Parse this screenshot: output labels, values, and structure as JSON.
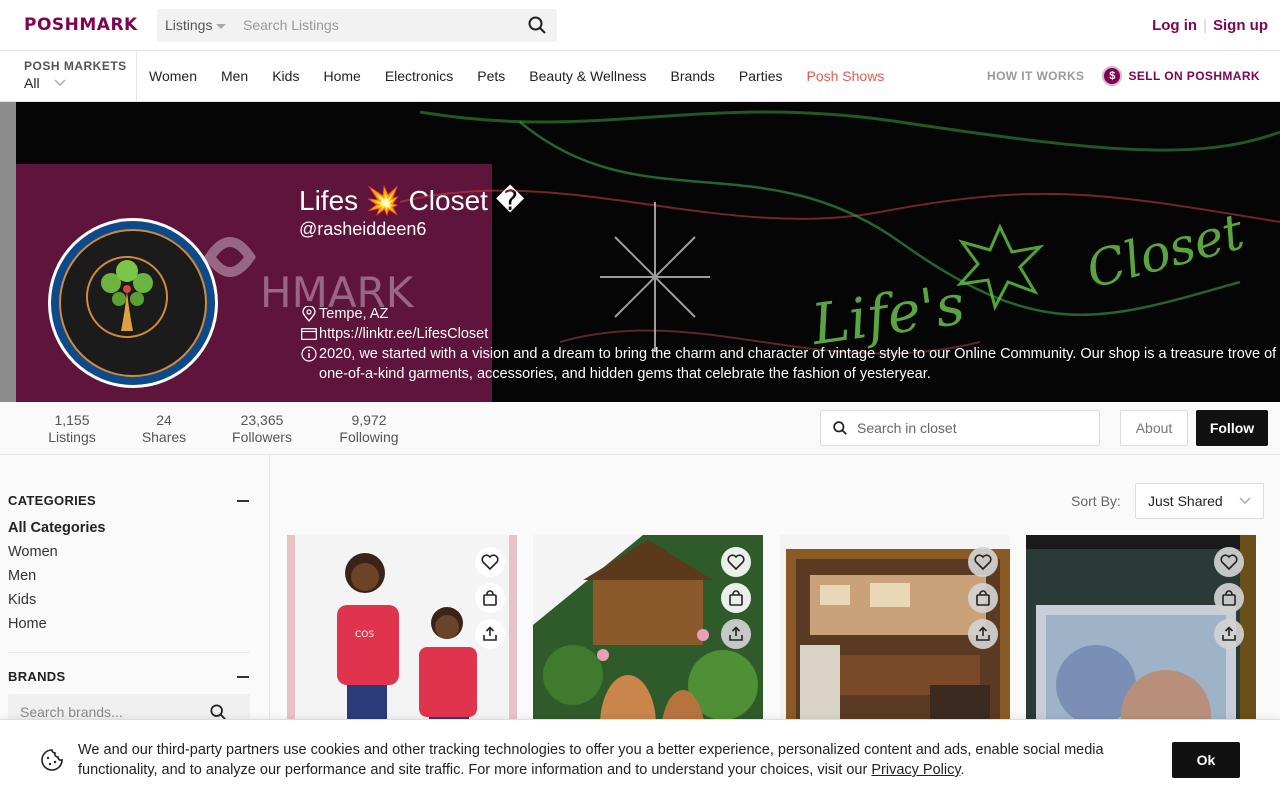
{
  "header": {
    "logo": "POSHMARK",
    "search_type": "Listings",
    "search_placeholder": "Search Listings",
    "login": "Log in",
    "signup": "Sign up"
  },
  "nav": {
    "markets_label": "POSH MARKETS",
    "markets_value": "All",
    "links": [
      "Women",
      "Men",
      "Kids",
      "Home",
      "Electronics",
      "Pets",
      "Beauty & Wellness",
      "Brands",
      "Parties",
      "Posh Shows"
    ],
    "how_it_works": "HOW IT WORKS",
    "sell": "SELL ON POSHMARK",
    "sell_badge": "$"
  },
  "profile": {
    "name": "Lifes 💥 Closet �",
    "handle": "@rasheiddeen6",
    "location": "Tempe, AZ",
    "website": "https://linktr.ee/LifesCloset",
    "bio": "2020, we started with a vision and a dream to bring the charm and character of vintage style to our Online Community. Our shop is a treasure trove of one-of-a-kind garments, accessories, and hidden gems that celebrate the fashion of yesteryear.",
    "banner_watermark": "HMARK",
    "banner_script": "Life's",
    "banner_script2": "Closet"
  },
  "stats": [
    {
      "value": "1,155",
      "label": "Listings"
    },
    {
      "value": "24",
      "label": "Shares"
    },
    {
      "value": "23,365",
      "label": "Followers"
    },
    {
      "value": "9,972",
      "label": "Following"
    }
  ],
  "closet_search_placeholder": "Search in closet",
  "about_label": "About",
  "follow_label": "Follow",
  "sidebar": {
    "categories_title": "CATEGORIES",
    "categories": [
      "All Categories",
      "Women",
      "Men",
      "Kids",
      "Home"
    ],
    "brands_title": "BRANDS",
    "brands_placeholder": "Search brands..."
  },
  "sort": {
    "label": "Sort By:",
    "value": "Just Shared"
  },
  "cookie": {
    "text": "We and our third-party partners use cookies and other tracking technologies to offer you a better experience, personalized content and ads, enable social media functionality, and to analyze our performance and site traffic. For more information and to understand your choices, visit our",
    "link": "Privacy Policy",
    "ok": "Ok"
  },
  "colors": {
    "brand": "#7f0353",
    "posh_shows": "#e05a4b"
  },
  "icons": [
    "search-icon",
    "caret-down-icon",
    "chevron-down-icon",
    "pin-icon",
    "web-icon",
    "info-icon",
    "heart-icon",
    "bag-icon",
    "share-icon",
    "cookie-icon",
    "minus-icon"
  ]
}
